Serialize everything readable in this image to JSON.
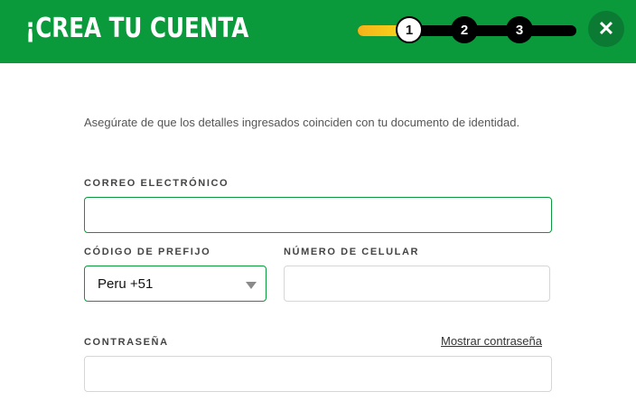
{
  "header": {
    "title": "¡CREA TU CUENTA",
    "steps": [
      "1",
      "2",
      "3"
    ],
    "progress_fraction": 0.2,
    "close_icon": "close-icon"
  },
  "form": {
    "intro": "Asegúrate de que los detalles ingresados coinciden con tu documento de identidad.",
    "email_label": "CORREO ELECTRÓNICO",
    "email_value": "",
    "prefix_label": "CÓDIGO DE PREFIJO",
    "prefix_value": "Peru +51",
    "phone_label": "NÚMERO DE CELULAR",
    "phone_value": "",
    "password_label": "CONTRASEÑA",
    "show_password": "Mostrar contraseña",
    "password_value": ""
  },
  "colors": {
    "brand_green": "#0a9a3c",
    "progress_yellow": "#f5b21a"
  }
}
